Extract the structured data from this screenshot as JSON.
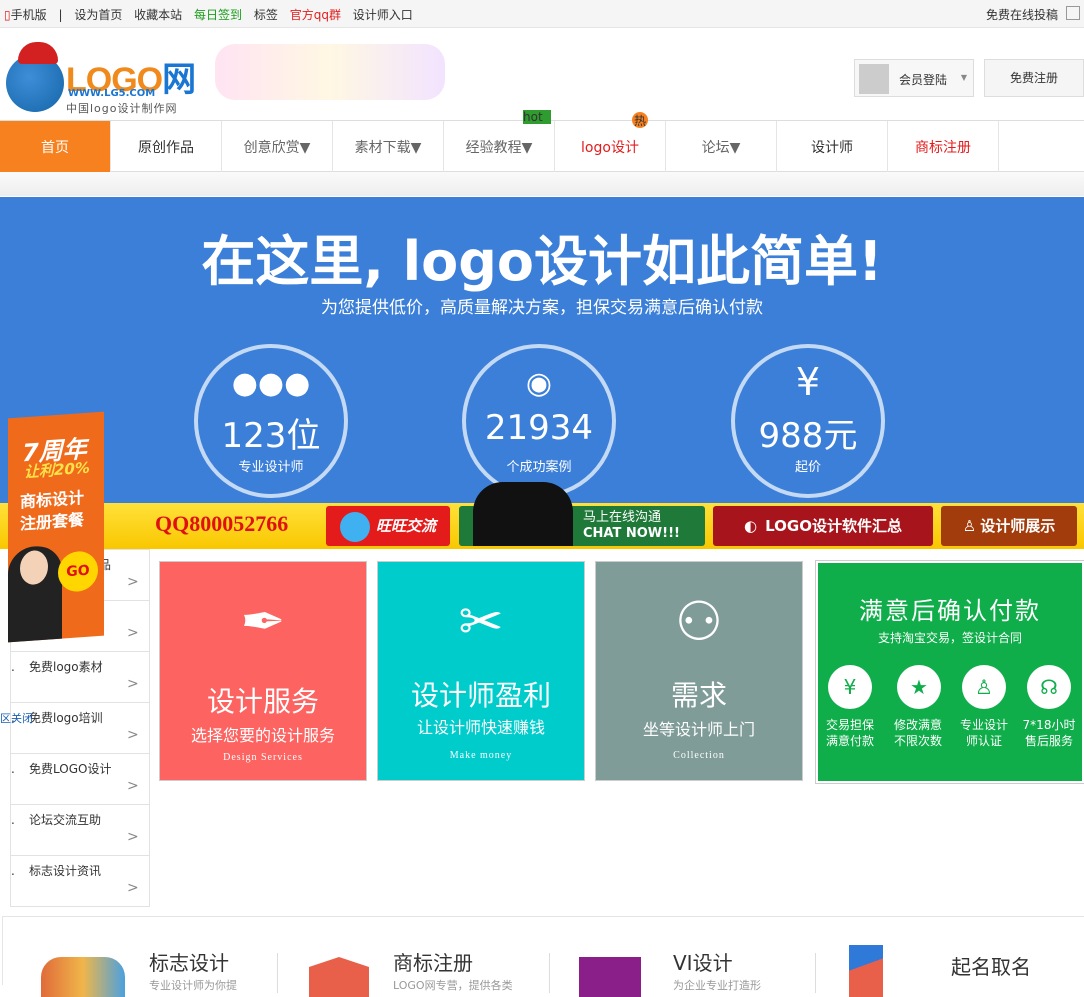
{
  "topbar": {
    "mobile": "手机版",
    "set_home": "设为首页",
    "bookmark": "收藏本站",
    "daily_sign": "每日签到",
    "tags": "标签",
    "qq_group": "官方qq群",
    "designer_entry": "设计师入口",
    "free_post": "免费在线投稿",
    "colors": {
      "green": "#1b9e1b",
      "red": "#e41c1c"
    }
  },
  "header": {
    "logo_text": "LOGO",
    "logo_text_suffix": "网",
    "logo_url": "WWW.LG5.COM",
    "logo_tagline": "中国logo设计制作网",
    "member_login": "会员登陆",
    "free_register": "免费注册"
  },
  "nav": {
    "items": [
      {
        "label": "首页"
      },
      {
        "label": "原创作品"
      },
      {
        "label": "创意欣赏▼"
      },
      {
        "label": "素材下载▼"
      },
      {
        "label": "经验教程▼"
      },
      {
        "label": "logo设计"
      },
      {
        "label": "论坛▼"
      },
      {
        "label": "设计师"
      },
      {
        "label": "商标注册"
      }
    ],
    "hot_tag": "hot",
    "hot_tag2": "热",
    "accent": "#f7811f"
  },
  "hero": {
    "title": "在这里, logo设计如此简单!",
    "subtitle": "为您提供低价，高质量解决方案，担保交易满意后确认付款",
    "stats": [
      {
        "icon": "users-icon",
        "value": "123位",
        "label": "专业设计师"
      },
      {
        "icon": "chat-bubble-icon",
        "value": "21934",
        "label": "个成功案例"
      },
      {
        "icon": "yen-icon",
        "value": "988元",
        "label": "起价"
      }
    ]
  },
  "yellow_bar": {
    "qq_number": "800052766",
    "wangwang": "旺旺交流",
    "online_chat_1": "马上在线沟通",
    "online_chat_2": "CHAT NOW!!!",
    "software": "LOGO设计软件汇总",
    "designer_show": "设计师展示"
  },
  "promo": {
    "line1": "7周年",
    "line2": "让利20%",
    "line3": "商标设计",
    "line4": "注册套餐",
    "go": "GO",
    "close": "关闭"
  },
  "sidebar": {
    "items": [
      {
        "label": "品"
      },
      {
        "label": ""
      },
      {
        "label": "免费logo素材"
      },
      {
        "label": "免费logo培训"
      },
      {
        "label": "免费LOGO设计"
      },
      {
        "label": "论坛交流互助"
      },
      {
        "label": "标志设计资讯"
      }
    ],
    "arrow": ">"
  },
  "cards": [
    {
      "title": "设计服务",
      "subtitle": "选择您要的设计服务",
      "en": "Design Services",
      "color": "#fd6360"
    },
    {
      "title": "设计师盈利",
      "subtitle": "让设计师快速赚钱",
      "en": "Make money",
      "color": "#00cccc"
    },
    {
      "title": "需求",
      "subtitle": "坐等设计师上门",
      "en": "Collection",
      "color": "#7f9c98"
    }
  ],
  "green_card": {
    "title": "满意后确认付款",
    "subtitle": "支持淘宝交易，签设计合同",
    "features": [
      {
        "icon": "yen-shield-icon",
        "line1": "交易担保",
        "line2": "满意付款"
      },
      {
        "icon": "star-badge-icon",
        "line1": "修改满意",
        "line2": "不限次数"
      },
      {
        "icon": "user-verify-icon",
        "line1": "专业设计",
        "line2": "师认证"
      },
      {
        "icon": "headset-icon",
        "line1": "7*18小时",
        "line2": "售后服务"
      }
    ],
    "color": "#0fae4a"
  },
  "bottom": {
    "items": [
      {
        "title": "标志设计",
        "desc": "专业设计师为你提"
      },
      {
        "title": "商标注册",
        "desc": "LOGO网专营，提供各类"
      },
      {
        "title": "VI设计",
        "desc": "为企业专业打造形"
      },
      {
        "title": "起名取名",
        "desc": ""
      }
    ]
  }
}
